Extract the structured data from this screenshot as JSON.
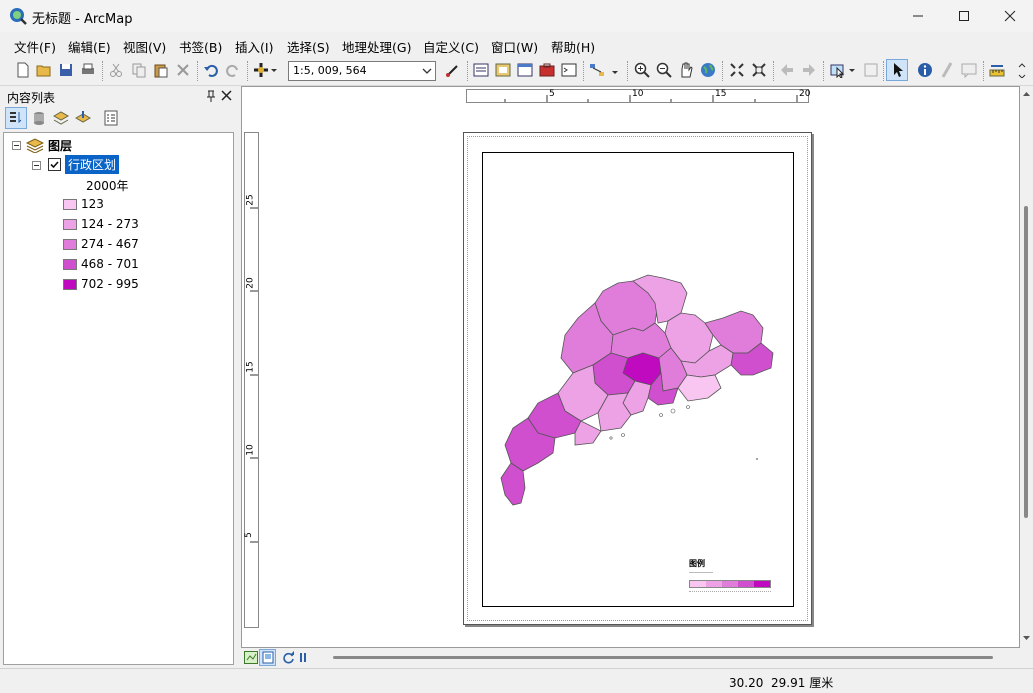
{
  "window": {
    "title": "无标题 - ArcMap",
    "controls": [
      "minimize",
      "maximize",
      "close"
    ]
  },
  "menu": [
    "文件(F)",
    "编辑(E)",
    "视图(V)",
    "书签(B)",
    "插入(I)",
    "选择(S)",
    "地理处理(G)",
    "自定义(C)",
    "窗口(W)",
    "帮助(H)"
  ],
  "toolbar": {
    "scale": "1:5, 009, 564"
  },
  "toc": {
    "title": "内容列表",
    "root": "图层",
    "layer": "行政区划",
    "field": "2000年",
    "classes": [
      {
        "label": "123",
        "color": "#f8c6f0"
      },
      {
        "label": "124 - 273",
        "color": "#eea2e6"
      },
      {
        "label": "274 - 467",
        "color": "#e07ddb"
      },
      {
        "label": "468 - 701",
        "color": "#cf4fcf"
      },
      {
        "label": "702 - 995",
        "color": "#c00ac0"
      }
    ]
  },
  "rulers": {
    "horizontal": [
      "5",
      "10",
      "15",
      "20"
    ],
    "vertical": [
      "25",
      "20",
      "15",
      "10",
      "5"
    ]
  },
  "layout": {
    "legend_title": "图例"
  },
  "status": {
    "x": "30.20",
    "y": "29.91",
    "unit": "厘米"
  }
}
